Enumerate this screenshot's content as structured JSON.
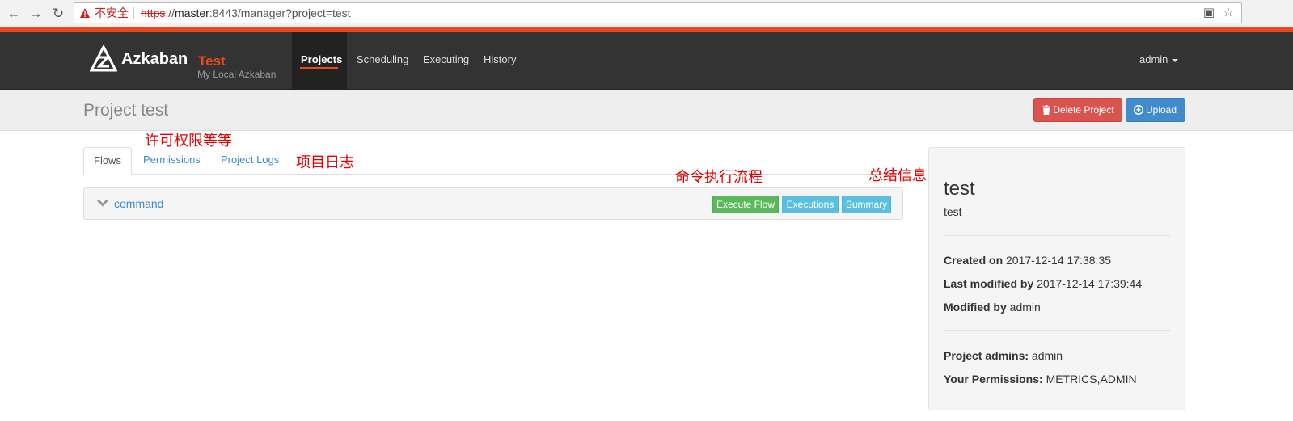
{
  "browser": {
    "security_label": "不安全",
    "url_scheme": "https",
    "url_sep": "://",
    "url_host": "master",
    "url_rest": ":8443/manager?project=test"
  },
  "navbar": {
    "brand": "Azkaban",
    "env": "Test",
    "subtitle": "My Local Azkaban",
    "items": [
      {
        "label": "Projects"
      },
      {
        "label": "Scheduling"
      },
      {
        "label": "Executing"
      },
      {
        "label": "History"
      }
    ],
    "user": "admin"
  },
  "header": {
    "title": "Project test",
    "delete_label": "Delete Project",
    "upload_label": "Upload"
  },
  "tabs": [
    {
      "label": "Flows"
    },
    {
      "label": "Permissions"
    },
    {
      "label": "Project Logs"
    }
  ],
  "flow": {
    "name": "command",
    "execute_label": "Execute Flow",
    "executions_label": "Executions",
    "summary_label": "Summary"
  },
  "info": {
    "name": "test",
    "description": "test",
    "created_label": "Created on",
    "created_value": "2017-12-14 17:38:35",
    "modified_label": "Last modified by",
    "modified_value": "2017-12-14 17:39:44",
    "modified_by_label": "Modified by",
    "modified_by_value": "admin",
    "admins_label": "Project admins:",
    "admins_value": "admin",
    "permissions_label": "Your Permissions:",
    "permissions_value": "METRICS,ADMIN"
  },
  "annotations": {
    "permissions_note": "许可权限等等",
    "logs_note": "项目日志",
    "execute_note": "命令执行流程",
    "summary_note": "总结信息"
  },
  "colors": {
    "accent": "#e8491d",
    "navbar_bg": "#333333",
    "danger": "#d9534f",
    "primary": "#428bca",
    "success": "#5cb85c",
    "info": "#5bc0de",
    "annotation": "#e60000"
  }
}
